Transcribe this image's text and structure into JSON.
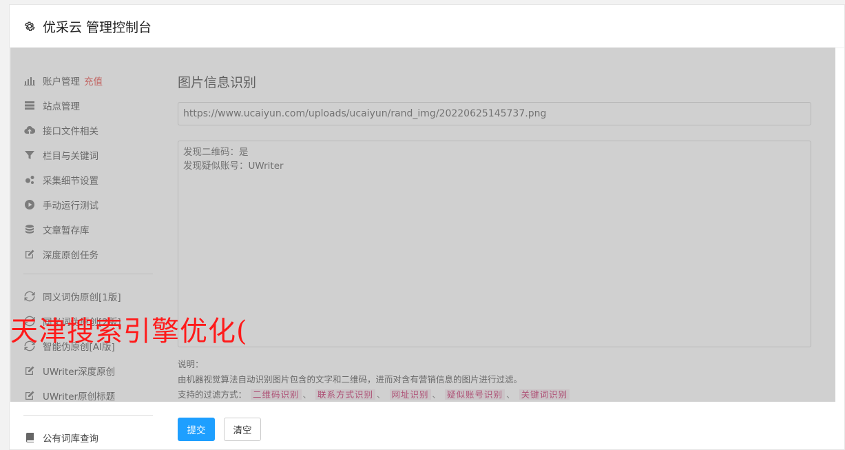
{
  "header": {
    "title": "优采云 管理控制台"
  },
  "sidebar": {
    "items": [
      {
        "label": "账户管理",
        "extra": "充值",
        "icon": "bar-chart-icon"
      },
      {
        "label": "站点管理",
        "icon": "server-icon"
      },
      {
        "label": "接口文件相关",
        "icon": "cloud-upload-icon"
      },
      {
        "label": "栏目与关键词",
        "icon": "filter-icon"
      },
      {
        "label": "采集细节设置",
        "icon": "gears-icon"
      },
      {
        "label": "手动运行测试",
        "icon": "play-circle-icon"
      },
      {
        "label": "文章暂存库",
        "icon": "database-icon"
      },
      {
        "label": "深度原创任务",
        "icon": "edit-icon"
      }
    ],
    "items2": [
      {
        "label": "同义词伪原创[1版]",
        "icon": "refresh-icon"
      },
      {
        "label": "同义词伪原创[2版]",
        "icon": "refresh-icon"
      },
      {
        "label": "智能伪原创[AI版]",
        "icon": "refresh-icon"
      },
      {
        "label": "UWriter深度原创",
        "icon": "edit-icon"
      },
      {
        "label": "UWriter原创标题",
        "icon": "edit-icon"
      }
    ],
    "items3": [
      {
        "label": "公有词库查询",
        "icon": "book-icon"
      }
    ]
  },
  "main": {
    "title": "图片信息识别",
    "url_value": "https://www.ucaiyun.com/uploads/ucaiyun/rand_img/20220625145737.png",
    "result_lines": [
      "发现二维码：是",
      "发现疑似账号：UWriter"
    ],
    "notes": {
      "heading": "说明：",
      "desc": "由机器视觉算法自动识别图片包含的文字和二维码，进而对含有营销信息的图片进行过滤。",
      "filters_label": "支持的过滤方式：",
      "filters": [
        "二维码识别",
        "联系方式识别",
        "网址识别",
        "疑似账号识别",
        "关键词识别"
      ],
      "separator": "、"
    },
    "submit_label": "提交",
    "clear_label": "清空"
  },
  "watermark": "天津搜索引擎优化("
}
